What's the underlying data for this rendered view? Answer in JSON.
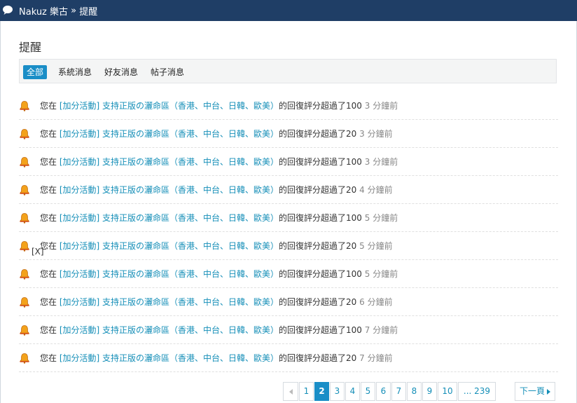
{
  "breadcrumb": {
    "site": "Nakuz 樂古",
    "separator": "»",
    "current": "提醒"
  },
  "page": {
    "title": "提醒"
  },
  "tabs": [
    {
      "label": "全部",
      "active": true
    },
    {
      "label": "系統消息",
      "active": false
    },
    {
      "label": "好友消息",
      "active": false
    },
    {
      "label": "帖子消息",
      "active": false
    }
  ],
  "notifications": [
    {
      "prefix": "您在",
      "link": "[加分活動] 支持正版の灑命區（香港、中台、日韓、歐美）",
      "suffix": "的回復評分超過了100",
      "time": "3 分鐘前"
    },
    {
      "prefix": "您在",
      "link": "[加分活動] 支持正版の灑命區（香港、中台、日韓、歐美）",
      "suffix": "的回復評分超過了20",
      "time": "3 分鐘前"
    },
    {
      "prefix": "您在",
      "link": "[加分活動] 支持正版の灑命區（香港、中台、日韓、歐美）",
      "suffix": "的回復評分超過了100",
      "time": "3 分鐘前"
    },
    {
      "prefix": "您在",
      "link": "[加分活動] 支持正版の灑命區（香港、中台、日韓、歐美）",
      "suffix": "的回復評分超過了20",
      "time": "4 分鐘前"
    },
    {
      "prefix": "您在",
      "link": "[加分活動] 支持正版の灑命區（香港、中台、日韓、歐美）",
      "suffix": "的回復評分超過了100",
      "time": "5 分鐘前"
    },
    {
      "prefix": "您在",
      "link": "[加分活動] 支持正版の灑命區（香港、中台、日韓、歐美）",
      "suffix": "的回復評分超過了20",
      "time": "5 分鐘前"
    },
    {
      "prefix": "您在",
      "link": "[加分活動] 支持正版の灑命區（香港、中台、日韓、歐美）",
      "suffix": "的回復評分超過了100",
      "time": "5 分鐘前"
    },
    {
      "prefix": "您在",
      "link": "[加分活動] 支持正版の灑命區（香港、中台、日韓、歐美）",
      "suffix": "的回復評分超過了20",
      "time": "6 分鐘前"
    },
    {
      "prefix": "您在",
      "link": "[加分活動] 支持正版の灑命區（香港、中台、日韓、歐美）",
      "suffix": "的回復評分超過了100",
      "time": "7 分鐘前"
    },
    {
      "prefix": "您在",
      "link": "[加分活動] 支持正版の灑命區（香港、中台、日韓、歐美）",
      "suffix": "的回復評分超過了20",
      "time": "7 分鐘前"
    }
  ],
  "close_mark": "[X]",
  "pagination": {
    "prev_icon": "prev-arrow-icon",
    "pages": [
      "1",
      "2",
      "3",
      "4",
      "5",
      "6",
      "7",
      "8",
      "9",
      "10"
    ],
    "current": "2",
    "last": "... 239",
    "next_label": "下一頁"
  },
  "colors": {
    "header": "#1f3e66",
    "accent": "#1a8ec7",
    "link": "#168fb8"
  }
}
